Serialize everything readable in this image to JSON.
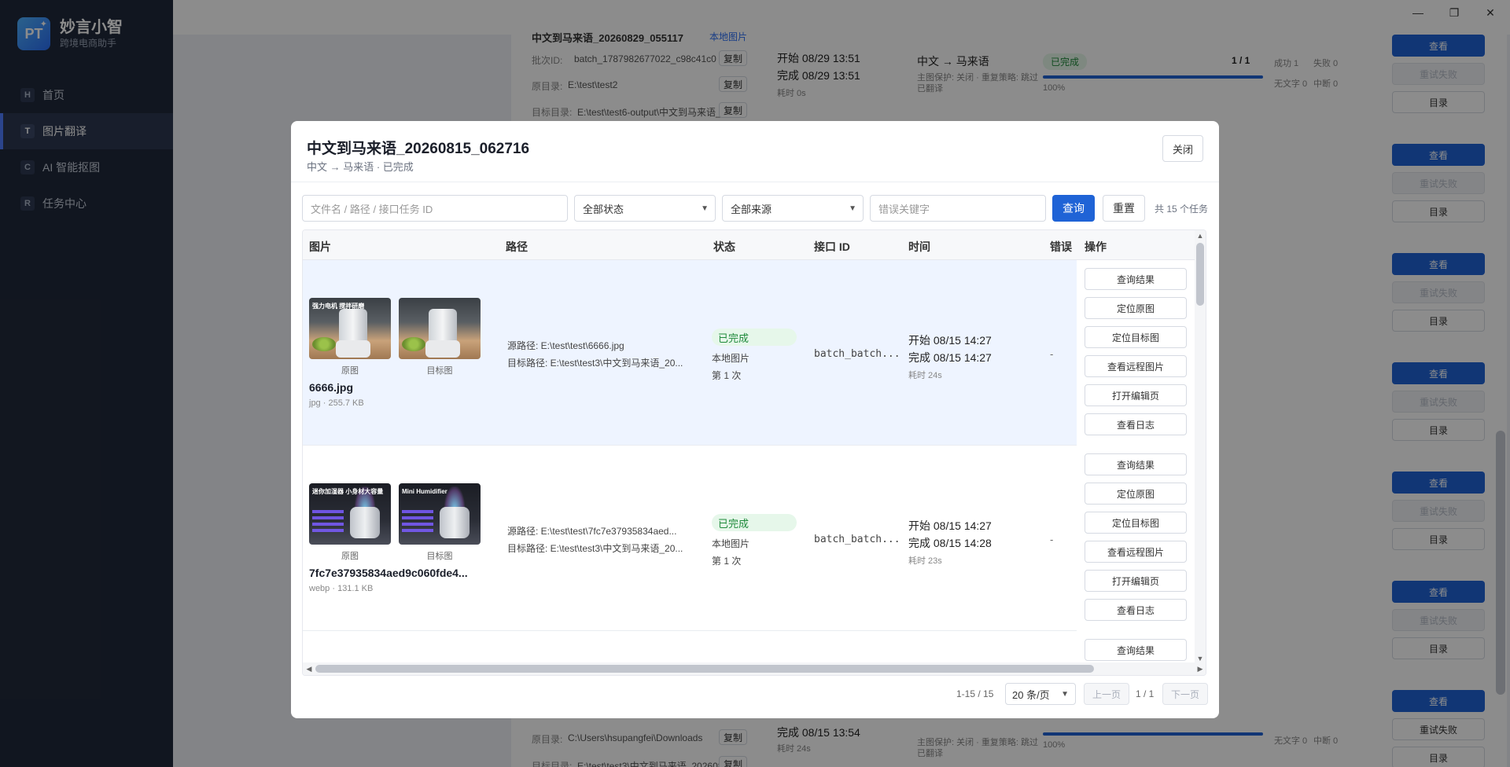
{
  "app": {
    "name": "妙言小智",
    "subtitle": "跨境电商助手",
    "logo_text": "PT"
  },
  "nav": [
    {
      "letter": "H",
      "label": "首页"
    },
    {
      "letter": "T",
      "label": "图片翻译"
    },
    {
      "letter": "C",
      "label": "AI 智能抠图"
    },
    {
      "letter": "R",
      "label": "任务中心"
    }
  ],
  "window": {
    "minimize": "—",
    "maximize": "❐",
    "close": "✕"
  },
  "background": {
    "top_title": "中文到马来语_20260829_055117",
    "top_tag": "本地图片",
    "batch_label": "批次ID:",
    "batch_id": "batch_1787982677022_c98c41c0",
    "src_label": "原目录:",
    "src_dir": "E:\\test\\test2",
    "dst_label": "目标目录:",
    "dst_dir": "E:\\test\\test6-output\\中文到马来语_20...",
    "copy": "复制",
    "start": "开始 08/29 13:51",
    "end": "完成 08/29 13:51",
    "duration": "耗时 0s",
    "lang": "中文 → 马来语",
    "options": "主图保护: 关闭 · 重复策略: 跳过",
    "options2": "已翻译",
    "status": "已完成",
    "count": "1 / 1",
    "pct": "100%",
    "success": "成功 1",
    "fail": "失败 0",
    "notext": "无文字 0",
    "interrupt": "中断 0",
    "btn_view": "查看",
    "btn_retry": "重试失败",
    "btn_dir": "目录",
    "bottom_end": "完成 08/15 13:54",
    "bottom_duration": "耗时 24s",
    "bottom_src": "C:\\Users\\hsupangfei\\Downloads",
    "bottom_dst": "E:\\test\\test3\\中文到马来语_20260815..."
  },
  "modal": {
    "title": "中文到马来语_20260815_062716",
    "subtitle": "中文 → 马来语 · 已完成",
    "close": "关闭",
    "search_placeholder": "文件名 / 路径 / 接口任务 ID",
    "status_select": "全部状态",
    "source_select": "全部来源",
    "error_placeholder": "错误关键字",
    "query": "查询",
    "reset": "重置",
    "total": "共 15 个任务",
    "columns": [
      "图片",
      "路径",
      "状态",
      "接口 ID",
      "时间",
      "错误",
      "操作"
    ],
    "rows": [
      {
        "src_caption": "原图",
        "dst_caption": "目标图",
        "thumb_text": "强力电机 搅拌研磨",
        "filename": "6666.jpg",
        "meta": "jpg · 255.7 KB",
        "src_path": "源路径: E:\\test\\test\\6666.jpg",
        "dst_path": "目标路径: E:\\test\\test3\\中文到马来语_20...",
        "status": "已完成",
        "source": "本地图片",
        "attempt": "第 1 次",
        "api_id": "batch_batch...",
        "start": "开始 08/15 14:27",
        "end": "完成 08/15 14:27",
        "duration": "耗时 24s",
        "error": "-"
      },
      {
        "src_caption": "原图",
        "dst_caption": "目标图",
        "thumb_text": "迷你加湿器 小身材大容量",
        "thumb_text_dst": "Mini Humidifier",
        "filename": "7fc7e37935834aed9c060fde4...",
        "meta": "webp · 131.1 KB",
        "src_path": "源路径: E:\\test\\test\\7fc7e37935834aed...",
        "dst_path": "目标路径: E:\\test\\test3\\中文到马来语_20...",
        "status": "已完成",
        "source": "本地图片",
        "attempt": "第 1 次",
        "api_id": "batch_batch...",
        "start": "开始 08/15 14:27",
        "end": "完成 08/15 14:28",
        "duration": "耗时 23s",
        "error": "-"
      }
    ],
    "ops": [
      "查询结果",
      "定位原图",
      "定位目标图",
      "查看远程图片",
      "打开编辑页",
      "查看日志"
    ],
    "pager": {
      "range": "1-15 / 15",
      "size": "20 条/页",
      "prev": "上一页",
      "page": "1 / 1",
      "next": "下一页"
    }
  }
}
